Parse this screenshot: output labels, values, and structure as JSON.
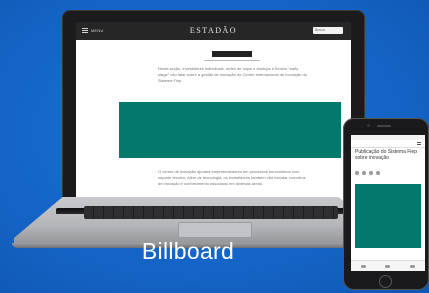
{
  "caption": "Billboard",
  "laptop_site": {
    "menu_label": "MENU",
    "logo": "ESTADÃO",
    "search_label": "Busca",
    "section_tag": "",
    "ad_label": "",
    "paragraph_top": "Nesta seção, investidores individuais, redes de anjos e startups e fundos “early stage” vão falar sobre a gestão de inovação do Centro Internacional de Inovação do Sistema Fiep.",
    "paragraph_bottom": "O centro de inovação ajudará empreendedores em processos burocráticos com suporte técnico. Além de tecnologia, os investidores também vão estudar conceitos de inovação e conhecimento associado em diversas áreas."
  },
  "phone_site": {
    "article_title": "Publicação do Sistema Fiep sobre inovação",
    "ad_label": ""
  },
  "colors": {
    "background": "#1565c8",
    "ad_fill": "#02796c",
    "caption": "#ffffff"
  }
}
